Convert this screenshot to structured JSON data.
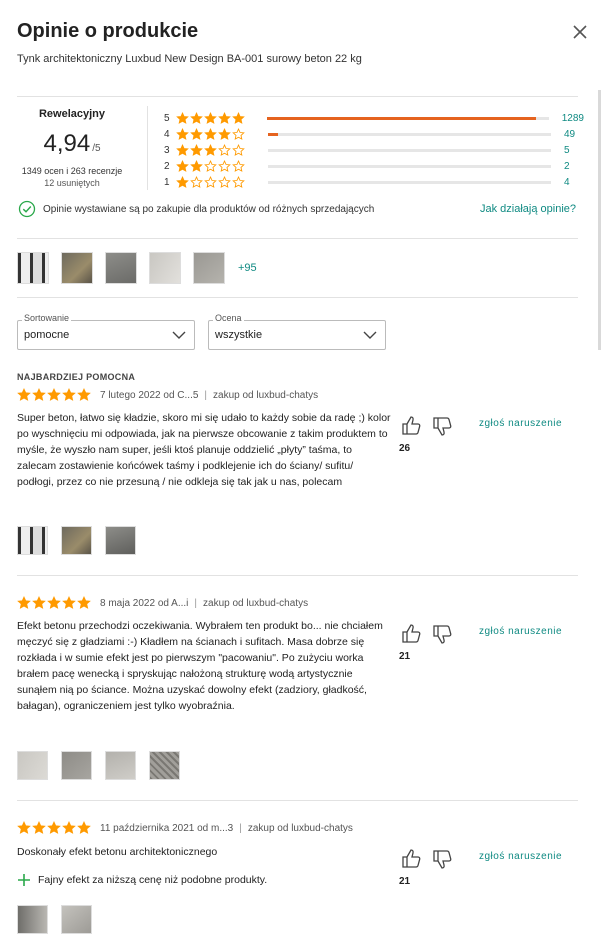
{
  "header": {
    "title": "Opinie o produkcie",
    "product": "Tynk architektoniczny Luxbud New Design BA-001 surowy beton 22 kg"
  },
  "summary": {
    "word": "Rewelacyjny",
    "score": "4,94",
    "scale": "/5",
    "counts": "1349 ocen i 263 recenzje",
    "removed": "12 usuniętych",
    "distribution": [
      {
        "stars": "5",
        "count": "1289",
        "fraction": 0.955
      },
      {
        "stars": "4",
        "count": "49",
        "fraction": 0.036
      },
      {
        "stars": "3",
        "count": "5",
        "fraction": 0.0
      },
      {
        "stars": "2",
        "count": "2",
        "fraction": 0.0
      },
      {
        "stars": "1",
        "count": "4",
        "fraction": 0.0
      }
    ],
    "verified_text": "Opinie wystawiane są po zakupie dla produktów od różnych sprzedających",
    "how_link": "Jak działają opinie?",
    "more_photos": "+95"
  },
  "filters": {
    "sort_label": "Sortowanie",
    "sort_value": "pomocne",
    "rating_label": "Ocena",
    "rating_value": "wszystkie"
  },
  "badge": "NAJBARDZIEJ POMOCNA",
  "reviews": [
    {
      "date": "7 lutego 2022 od C...5",
      "seller": "zakup od luxbud-chatys",
      "text": "Super beton, łatwo się kładzie, skoro mi się udało to każdy sobie da radę ;) kolor po wyschnięciu mi odpowiada, jak na pierwsze obcowanie z takim produktem to myśle, że wyszło nam super, jeśli ktoś planuje oddzielić „płyty” taśma, to zalecam zostawienie końcówek taśmy i podklejenie ich do ściany/ sufitu/ podłogi, przez co nie przesuną / nie odkleja się tak jak u nas, polecam",
      "likes": "26",
      "report": "zgłoś naruszenie"
    },
    {
      "date": "8 maja 2022 od A...i",
      "seller": "zakup od luxbud-chatys",
      "text": "Efekt betonu przechodzi oczekiwania. Wybrałem ten produkt bo... nie chciałem męczyć się z gładziami :-) Kładłem na ścianach i sufitach. Masa dobrze się rozkłada i w sumie efekt jest po pierwszym \"pacowaniu\". Po zużyciu worka brałem pacę wenecką i spryskując nałożoną strukturę wodą artystycznie sunąłem nią po ściance. Można uzyskać dowolny efekt (zadziory, gładkość, bałagan), ograniczeniem jest tylko wyobraźnia.",
      "likes": "21",
      "report": "zgłoś naruszenie"
    },
    {
      "date": "11 października 2021 od m...3",
      "seller": "zakup od luxbud-chatys",
      "text": "Doskonały efekt betonu architektonicznego",
      "pro": "Fajny efekt za niższą cenę niż podobne produkty.",
      "likes": "21",
      "report": "zgłoś naruszenie"
    }
  ],
  "colors": {
    "accent": "#e5631f",
    "link": "#0f8a82",
    "star": "#ff9a00",
    "verified": "#2aa84a"
  }
}
